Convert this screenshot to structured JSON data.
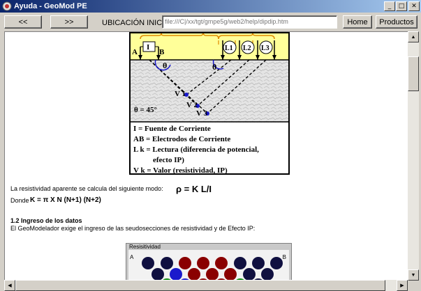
{
  "window": {
    "title": "Ayuda - GeoMod PE"
  },
  "toolbar": {
    "back_label": "<<",
    "forward_label": ">>",
    "url_label": "UBICACIÓN INICIAL:",
    "url_value": "file:///C|/xx/tgt/gmpe5g/web2/help/dipdip.htm",
    "home_label": "Home",
    "products_label": "Productos"
  },
  "diagram": {
    "labels": {
      "source": "I",
      "a": "A",
      "b": "B",
      "l1": "L1",
      "l2": "L2",
      "l3": "L3",
      "theta": "θ",
      "angle": "θ = 45°",
      "v1": "V 1",
      "v2": "V 2",
      "v3": "V 3"
    },
    "legend": [
      "I = Fuente de Corriente",
      "AB = Electrodos de Corriente",
      "L k = Lectura (diferencia  de potencial,",
      "efecto IP)",
      "V k = Valor (resistividad, IP)"
    ]
  },
  "content": {
    "resistivity_text": "La resistividad aparente se calcula del siguiente modo:",
    "rho_formula": "ρ = K  L/I",
    "donde": "Donde",
    "k_formula": "K = π X N (N+1) (N+2)",
    "section_title": "1.2 Ingreso de los datos",
    "section_text": "El GeoModelador exige el ingreso de las seudosecciones de resistividad y de Efecto IP:"
  },
  "board": {
    "title": "Resisitividad",
    "a": "A",
    "b": "B"
  },
  "colors": {
    "titlebar_start": "#0a246a",
    "titlebar_end": "#a6caf0",
    "dot_navy": "#101040",
    "dot_red": "#8a0000",
    "dot_blue": "#1a1acc",
    "dot_green": "#0a8a0a"
  }
}
